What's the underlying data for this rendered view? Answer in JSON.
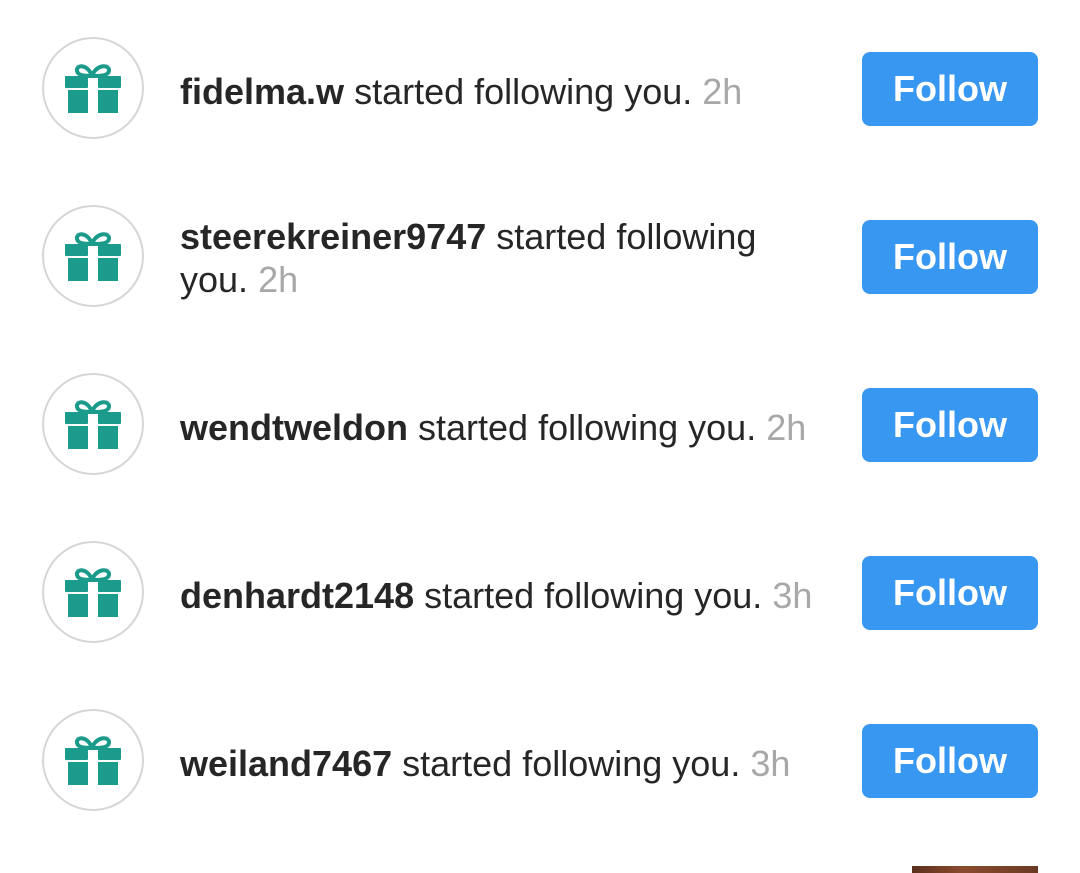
{
  "colors": {
    "accent": "#3897f0",
    "gift_icon": "#1a9b8c",
    "username": "#262626",
    "timestamp": "#a8a8a8"
  },
  "notifications": [
    {
      "username": "fidelma.w",
      "action": "started following you.",
      "time": "2h",
      "button_label": "Follow",
      "icon": "gift-icon"
    },
    {
      "username": "steerekreiner9747",
      "action": "started following you.",
      "time": "2h",
      "button_label": "Follow",
      "icon": "gift-icon"
    },
    {
      "username": "wendtweldon",
      "action": "started following you.",
      "time": "2h",
      "button_label": "Follow",
      "icon": "gift-icon"
    },
    {
      "username": "denhardt2148",
      "action": "started following you.",
      "time": "3h",
      "button_label": "Follow",
      "icon": "gift-icon"
    },
    {
      "username": "weiland7467",
      "action": "started following you.",
      "time": "3h",
      "button_label": "Follow",
      "icon": "gift-icon"
    }
  ]
}
